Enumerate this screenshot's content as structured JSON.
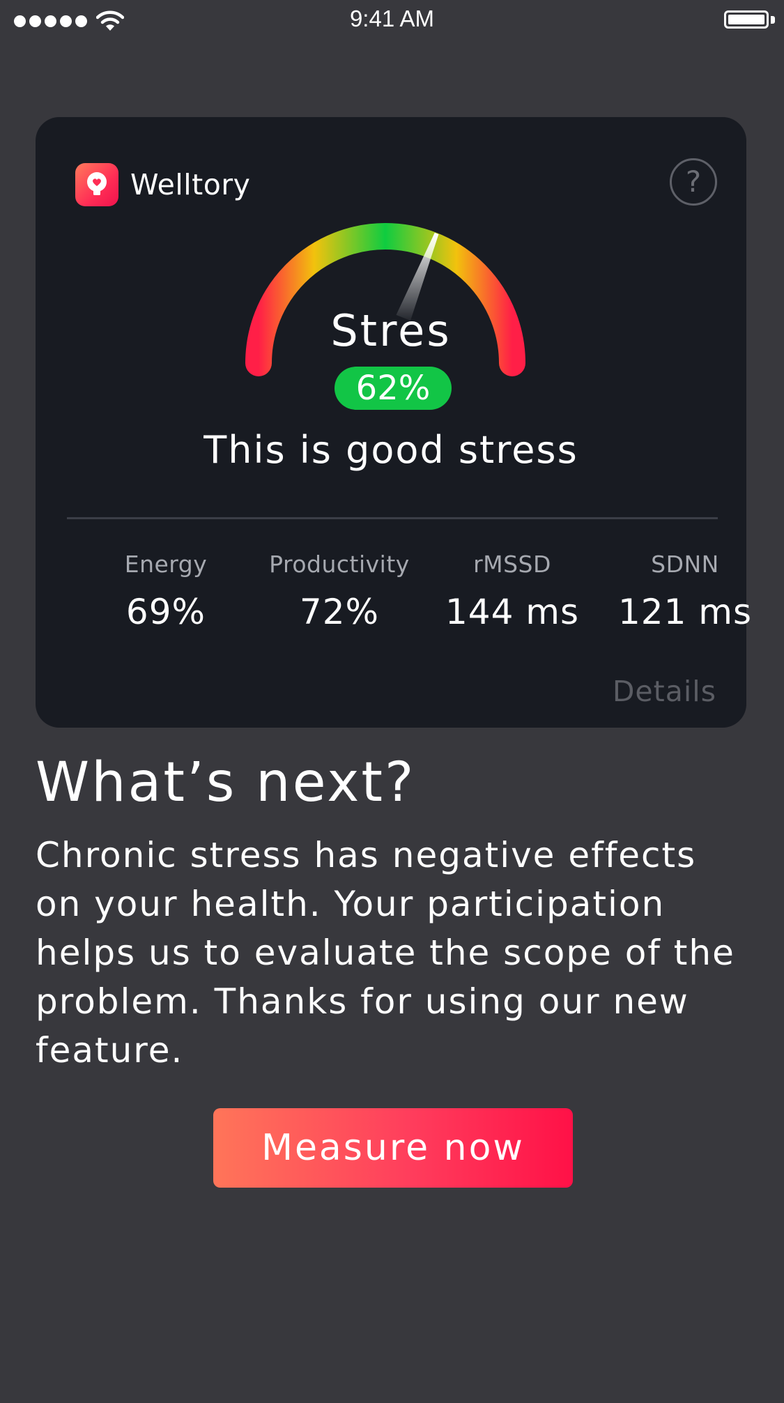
{
  "status_bar": {
    "time": "9:41 AM",
    "signal_bars": 5,
    "signal_icon": "signal-dots-icon",
    "wifi_icon": "wifi-icon",
    "battery_icon": "battery-icon",
    "battery_level": 1.0
  },
  "card": {
    "brand": {
      "name": "Welltory",
      "logo_icon": "welltory-heart-bulb-icon"
    },
    "help_icon": "help-question-icon",
    "help_label": "?",
    "gauge": {
      "title": "Stres",
      "value": "62%",
      "needle_fraction": 0.62,
      "caption": "This is good stress",
      "colors": {
        "start": "#ff1f47",
        "low": "#f2c20d",
        "mid": "#0fcc40",
        "high": "#f2c20d",
        "end": "#ff1f47",
        "badge": "#12c546"
      }
    },
    "metrics": [
      {
        "label": "Energy",
        "value": "69%"
      },
      {
        "label": "Productivity",
        "value": "72%"
      },
      {
        "label": "rMSSD",
        "value": "144 ms"
      },
      {
        "label": "SDNN",
        "value": "121 ms"
      }
    ],
    "details_label": "Details"
  },
  "next": {
    "title": "What’s next?",
    "body": "Chronic stress has negative effects on your health. Your participation helps us to evaluate the scope of the problem. Thanks for using our new feature."
  },
  "cta": {
    "label": "Measure now",
    "gradient_start": "#ff7559",
    "gradient_end": "#ff1147"
  }
}
